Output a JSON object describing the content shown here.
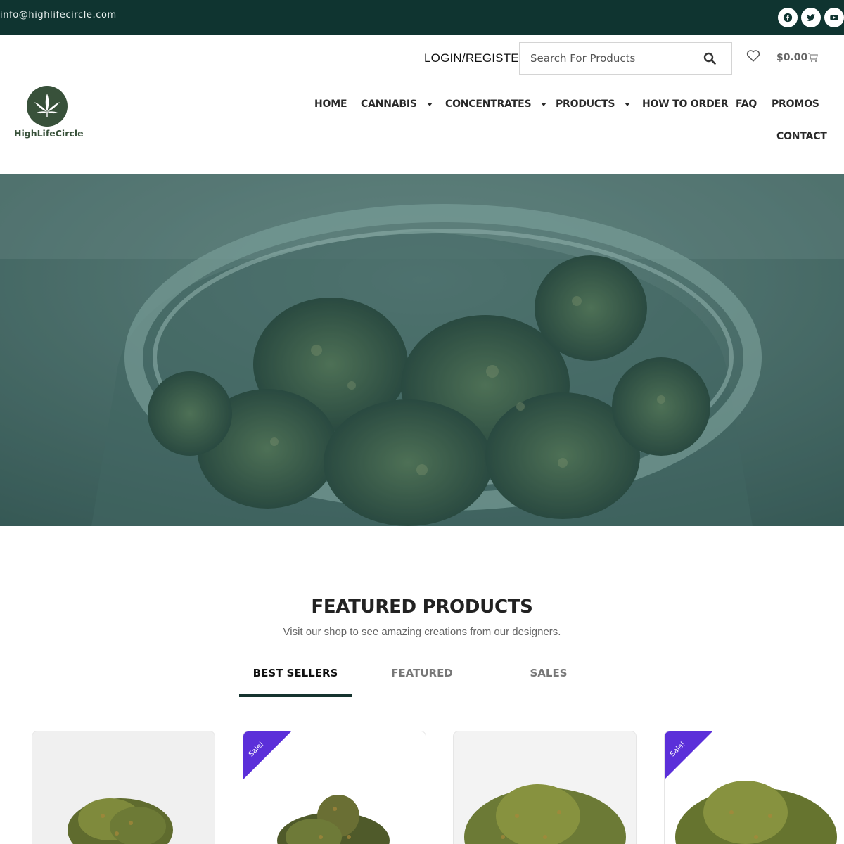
{
  "topbar": {
    "email": "info@highlifecircle.com",
    "social": [
      "facebook-icon",
      "twitter-icon",
      "youtube-icon"
    ],
    "bg_color": "#0f3430"
  },
  "header": {
    "login_label": "LOGIN/REGISTER",
    "search_placeholder": "Search For Products",
    "cart_total": "$0.00",
    "brand": "HighLifeCircle",
    "logo_color": "#38513a"
  },
  "nav": {
    "items": [
      {
        "label": "HOME",
        "dropdown": false
      },
      {
        "label": "CANNABIS",
        "dropdown": true
      },
      {
        "label": "CONCENTRATES",
        "dropdown": true
      },
      {
        "label": "PRODUCTS",
        "dropdown": true
      },
      {
        "label": "HOW TO ORDER",
        "dropdown": false
      },
      {
        "label": "FAQ",
        "dropdown": false
      },
      {
        "label": "PROMOS",
        "dropdown": false
      },
      {
        "label": "CONTACT",
        "dropdown": false
      }
    ]
  },
  "featured": {
    "title": "FEATURED PRODUCTS",
    "subtitle": "Visit our shop to see amazing creations from our designers.",
    "tabs": [
      "BEST SELLERS",
      "FEATURED",
      "SALES"
    ],
    "active_tab": "BEST SELLERS"
  },
  "products": [
    {
      "sale": false
    },
    {
      "sale": true,
      "badge": "Sale!"
    },
    {
      "sale": false
    },
    {
      "sale": true,
      "badge": "Sale!"
    }
  ],
  "colors": {
    "accent_dark": "#16332f",
    "sale_badge": "#5b2fd9"
  }
}
